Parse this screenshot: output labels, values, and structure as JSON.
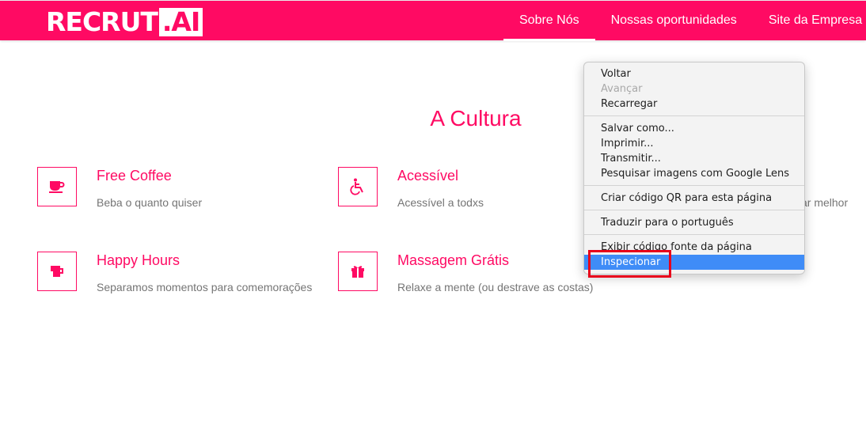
{
  "brand": {
    "logo_main": "RECRUT",
    "logo_ai": ".AI",
    "primary_color": "#ff0a63"
  },
  "nav": {
    "items": [
      {
        "label": "Sobre Nós",
        "active": true
      },
      {
        "label": "Nossas oportunidades",
        "active": false
      },
      {
        "label": "Site da Empresa",
        "active": false
      }
    ]
  },
  "section": {
    "title": "A Cultura"
  },
  "features": [
    {
      "title": "Free Coffee",
      "description": "Beba o quanto quiser",
      "icon": "coffee-icon"
    },
    {
      "title": "Acessível",
      "description": "Acessível a todxs",
      "icon": "wheelchair-icon"
    },
    {
      "title": "Happy Hours",
      "description": "Separamos momentos para comemorações",
      "icon": "beer-icon"
    },
    {
      "title": "Massagem Grátis",
      "description": "Relaxe a mente (ou destrave as costas)",
      "icon": "gift-icon"
    }
  ],
  "partial_text": "ar melhor",
  "context_menu": {
    "items": [
      {
        "label": "Voltar",
        "disabled": false
      },
      {
        "label": "Avançar",
        "disabled": true
      },
      {
        "label": "Recarregar",
        "disabled": false
      },
      {
        "label": "Salvar como...",
        "disabled": false
      },
      {
        "label": "Imprimir...",
        "disabled": false
      },
      {
        "label": "Transmitir...",
        "disabled": false
      },
      {
        "label": "Pesquisar imagens com Google Lens",
        "disabled": false
      },
      {
        "label": "Criar código QR para esta página",
        "disabled": false
      },
      {
        "label": "Traduzir para o português",
        "disabled": false
      },
      {
        "label": "Exibir código fonte da página",
        "disabled": false
      },
      {
        "label": "Inspecionar",
        "disabled": false,
        "selected": true
      }
    ],
    "highlight_color": "#e8001b",
    "selected_color": "#3f8cf7"
  }
}
